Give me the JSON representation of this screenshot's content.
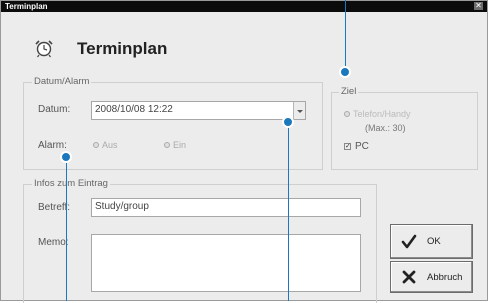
{
  "window": {
    "title": "Terminplan",
    "close_glyph": "✕"
  },
  "header": {
    "heading": "Terminplan",
    "icon": "alarm-clock-icon"
  },
  "date_alarm": {
    "legend": "Datum/Alarm",
    "date_label": "Datum:",
    "date_value": "2008/10/08 12:22",
    "alarm_label": "Alarm:",
    "alarm_options": [
      "Aus",
      "Ein"
    ]
  },
  "target": {
    "legend": "Ziel",
    "options": [
      {
        "label": "Telefon/Handy",
        "note": "(Max.: 30)",
        "state": "disabled"
      },
      {
        "label": "PC",
        "state": "checked"
      }
    ]
  },
  "entry": {
    "legend": "Infos zum Eintrag",
    "subject_label": "Betreff:",
    "subject_value": "Study/group",
    "memo_label": "Memo:",
    "memo_value": ""
  },
  "buttons": {
    "ok": "OK",
    "cancel": "Abbruch"
  },
  "colors": {
    "titlebar": "#0c0c0c",
    "background": "#ececec",
    "marker": "#1c78bd"
  }
}
